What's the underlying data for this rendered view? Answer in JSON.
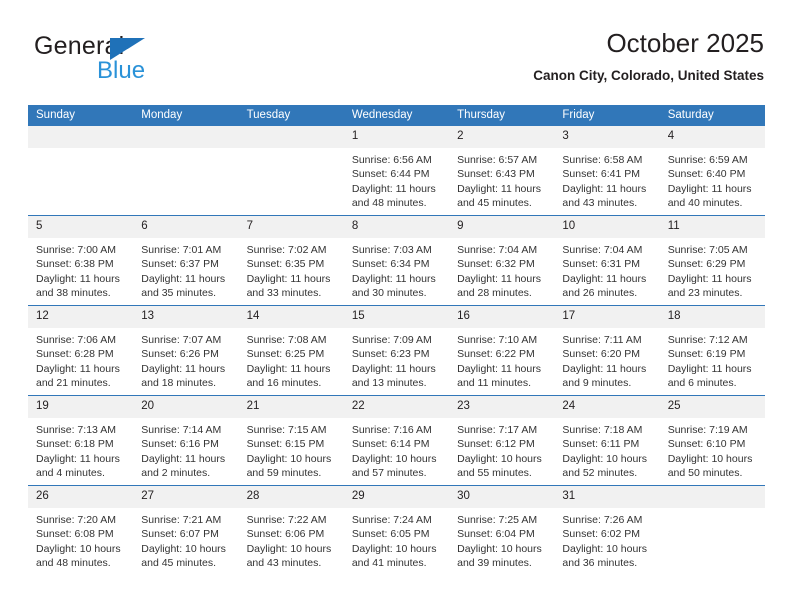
{
  "brand": {
    "line1": "General",
    "line2": "Blue",
    "triangle_color": "#1f71b8",
    "blue_text_color": "#2a92d8"
  },
  "header": {
    "title": "October 2025",
    "subtitle": "Canon City, Colorado, United States"
  },
  "theme": {
    "header_bg": "#3177b9",
    "daynum_bg": "#f1f1f1",
    "row_divider": "#3177b9",
    "text": "#231f20"
  },
  "weekdays": [
    "Sunday",
    "Monday",
    "Tuesday",
    "Wednesday",
    "Thursday",
    "Friday",
    "Saturday"
  ],
  "weeks": [
    [
      {
        "day": "",
        "sunrise": "",
        "sunset": "",
        "daylight1": "",
        "daylight2": ""
      },
      {
        "day": "",
        "sunrise": "",
        "sunset": "",
        "daylight1": "",
        "daylight2": ""
      },
      {
        "day": "",
        "sunrise": "",
        "sunset": "",
        "daylight1": "",
        "daylight2": ""
      },
      {
        "day": "1",
        "sunrise": "Sunrise: 6:56 AM",
        "sunset": "Sunset: 6:44 PM",
        "daylight1": "Daylight: 11 hours",
        "daylight2": "and 48 minutes."
      },
      {
        "day": "2",
        "sunrise": "Sunrise: 6:57 AM",
        "sunset": "Sunset: 6:43 PM",
        "daylight1": "Daylight: 11 hours",
        "daylight2": "and 45 minutes."
      },
      {
        "day": "3",
        "sunrise": "Sunrise: 6:58 AM",
        "sunset": "Sunset: 6:41 PM",
        "daylight1": "Daylight: 11 hours",
        "daylight2": "and 43 minutes."
      },
      {
        "day": "4",
        "sunrise": "Sunrise: 6:59 AM",
        "sunset": "Sunset: 6:40 PM",
        "daylight1": "Daylight: 11 hours",
        "daylight2": "and 40 minutes."
      }
    ],
    [
      {
        "day": "5",
        "sunrise": "Sunrise: 7:00 AM",
        "sunset": "Sunset: 6:38 PM",
        "daylight1": "Daylight: 11 hours",
        "daylight2": "and 38 minutes."
      },
      {
        "day": "6",
        "sunrise": "Sunrise: 7:01 AM",
        "sunset": "Sunset: 6:37 PM",
        "daylight1": "Daylight: 11 hours",
        "daylight2": "and 35 minutes."
      },
      {
        "day": "7",
        "sunrise": "Sunrise: 7:02 AM",
        "sunset": "Sunset: 6:35 PM",
        "daylight1": "Daylight: 11 hours",
        "daylight2": "and 33 minutes."
      },
      {
        "day": "8",
        "sunrise": "Sunrise: 7:03 AM",
        "sunset": "Sunset: 6:34 PM",
        "daylight1": "Daylight: 11 hours",
        "daylight2": "and 30 minutes."
      },
      {
        "day": "9",
        "sunrise": "Sunrise: 7:04 AM",
        "sunset": "Sunset: 6:32 PM",
        "daylight1": "Daylight: 11 hours",
        "daylight2": "and 28 minutes."
      },
      {
        "day": "10",
        "sunrise": "Sunrise: 7:04 AM",
        "sunset": "Sunset: 6:31 PM",
        "daylight1": "Daylight: 11 hours",
        "daylight2": "and 26 minutes."
      },
      {
        "day": "11",
        "sunrise": "Sunrise: 7:05 AM",
        "sunset": "Sunset: 6:29 PM",
        "daylight1": "Daylight: 11 hours",
        "daylight2": "and 23 minutes."
      }
    ],
    [
      {
        "day": "12",
        "sunrise": "Sunrise: 7:06 AM",
        "sunset": "Sunset: 6:28 PM",
        "daylight1": "Daylight: 11 hours",
        "daylight2": "and 21 minutes."
      },
      {
        "day": "13",
        "sunrise": "Sunrise: 7:07 AM",
        "sunset": "Sunset: 6:26 PM",
        "daylight1": "Daylight: 11 hours",
        "daylight2": "and 18 minutes."
      },
      {
        "day": "14",
        "sunrise": "Sunrise: 7:08 AM",
        "sunset": "Sunset: 6:25 PM",
        "daylight1": "Daylight: 11 hours",
        "daylight2": "and 16 minutes."
      },
      {
        "day": "15",
        "sunrise": "Sunrise: 7:09 AM",
        "sunset": "Sunset: 6:23 PM",
        "daylight1": "Daylight: 11 hours",
        "daylight2": "and 13 minutes."
      },
      {
        "day": "16",
        "sunrise": "Sunrise: 7:10 AM",
        "sunset": "Sunset: 6:22 PM",
        "daylight1": "Daylight: 11 hours",
        "daylight2": "and 11 minutes."
      },
      {
        "day": "17",
        "sunrise": "Sunrise: 7:11 AM",
        "sunset": "Sunset: 6:20 PM",
        "daylight1": "Daylight: 11 hours",
        "daylight2": "and 9 minutes."
      },
      {
        "day": "18",
        "sunrise": "Sunrise: 7:12 AM",
        "sunset": "Sunset: 6:19 PM",
        "daylight1": "Daylight: 11 hours",
        "daylight2": "and 6 minutes."
      }
    ],
    [
      {
        "day": "19",
        "sunrise": "Sunrise: 7:13 AM",
        "sunset": "Sunset: 6:18 PM",
        "daylight1": "Daylight: 11 hours",
        "daylight2": "and 4 minutes."
      },
      {
        "day": "20",
        "sunrise": "Sunrise: 7:14 AM",
        "sunset": "Sunset: 6:16 PM",
        "daylight1": "Daylight: 11 hours",
        "daylight2": "and 2 minutes."
      },
      {
        "day": "21",
        "sunrise": "Sunrise: 7:15 AM",
        "sunset": "Sunset: 6:15 PM",
        "daylight1": "Daylight: 10 hours",
        "daylight2": "and 59 minutes."
      },
      {
        "day": "22",
        "sunrise": "Sunrise: 7:16 AM",
        "sunset": "Sunset: 6:14 PM",
        "daylight1": "Daylight: 10 hours",
        "daylight2": "and 57 minutes."
      },
      {
        "day": "23",
        "sunrise": "Sunrise: 7:17 AM",
        "sunset": "Sunset: 6:12 PM",
        "daylight1": "Daylight: 10 hours",
        "daylight2": "and 55 minutes."
      },
      {
        "day": "24",
        "sunrise": "Sunrise: 7:18 AM",
        "sunset": "Sunset: 6:11 PM",
        "daylight1": "Daylight: 10 hours",
        "daylight2": "and 52 minutes."
      },
      {
        "day": "25",
        "sunrise": "Sunrise: 7:19 AM",
        "sunset": "Sunset: 6:10 PM",
        "daylight1": "Daylight: 10 hours",
        "daylight2": "and 50 minutes."
      }
    ],
    [
      {
        "day": "26",
        "sunrise": "Sunrise: 7:20 AM",
        "sunset": "Sunset: 6:08 PM",
        "daylight1": "Daylight: 10 hours",
        "daylight2": "and 48 minutes."
      },
      {
        "day": "27",
        "sunrise": "Sunrise: 7:21 AM",
        "sunset": "Sunset: 6:07 PM",
        "daylight1": "Daylight: 10 hours",
        "daylight2": "and 45 minutes."
      },
      {
        "day": "28",
        "sunrise": "Sunrise: 7:22 AM",
        "sunset": "Sunset: 6:06 PM",
        "daylight1": "Daylight: 10 hours",
        "daylight2": "and 43 minutes."
      },
      {
        "day": "29",
        "sunrise": "Sunrise: 7:24 AM",
        "sunset": "Sunset: 6:05 PM",
        "daylight1": "Daylight: 10 hours",
        "daylight2": "and 41 minutes."
      },
      {
        "day": "30",
        "sunrise": "Sunrise: 7:25 AM",
        "sunset": "Sunset: 6:04 PM",
        "daylight1": "Daylight: 10 hours",
        "daylight2": "and 39 minutes."
      },
      {
        "day": "31",
        "sunrise": "Sunrise: 7:26 AM",
        "sunset": "Sunset: 6:02 PM",
        "daylight1": "Daylight: 10 hours",
        "daylight2": "and 36 minutes."
      },
      {
        "day": "",
        "sunrise": "",
        "sunset": "",
        "daylight1": "",
        "daylight2": ""
      }
    ]
  ]
}
